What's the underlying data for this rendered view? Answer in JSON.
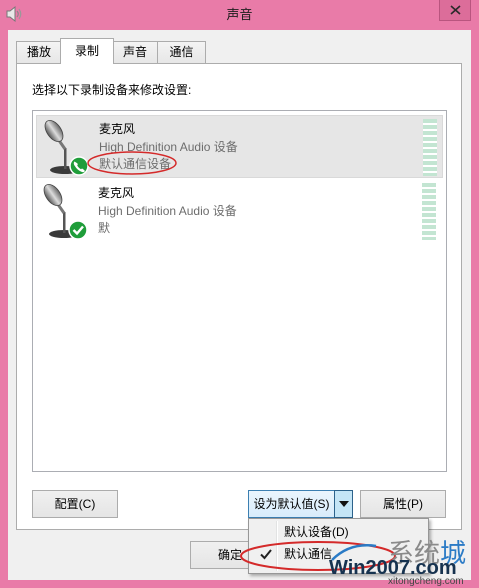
{
  "window": {
    "title": "声音",
    "icon": "speaker-icon",
    "close_icon": "close-icon",
    "frame_color": "#e97ba8"
  },
  "tabs": [
    {
      "label": "播放",
      "selected": false
    },
    {
      "label": "录制",
      "selected": true
    },
    {
      "label": "声音",
      "selected": false
    },
    {
      "label": "通信",
      "selected": false
    }
  ],
  "instruction": "选择以下录制设备来修改设置:",
  "devices": [
    {
      "name": "麦克风",
      "description": "High Definition Audio 设备",
      "status": "默认通信设备",
      "icon": "microphone-icon",
      "badge": "phone-badge-icon",
      "selected": true
    },
    {
      "name": "麦克风",
      "description": "High Definition Audio 设备",
      "status": "默",
      "icon": "microphone-icon",
      "badge": "checkmark-badge-icon",
      "selected": false
    }
  ],
  "buttons": {
    "configure": "配置(C)",
    "set_default": "设为默认值(S)",
    "set_default_arrow_icon": "dropdown-arrow-icon",
    "properties": "属性(P)",
    "ok": "确定"
  },
  "default_menu": {
    "items": [
      {
        "label": "默认设备(D)",
        "checked": false
      },
      {
        "label": "默认通信",
        "checked": true,
        "icon": "checkmark-icon"
      }
    ]
  },
  "annotations": {
    "stroke_color": "#d42a2a"
  },
  "watermark": {
    "brand_cn": [
      "系统",
      "城"
    ],
    "brand_en": "Win2007.com",
    "domain": "xitongcheng.com",
    "text_color": "#16324f",
    "accent_color": "#2b7bc6"
  },
  "colors": {
    "badge_green": "#1f9d3a",
    "meter": "#c3e5d2",
    "selected_row": "#e6e6e6"
  }
}
